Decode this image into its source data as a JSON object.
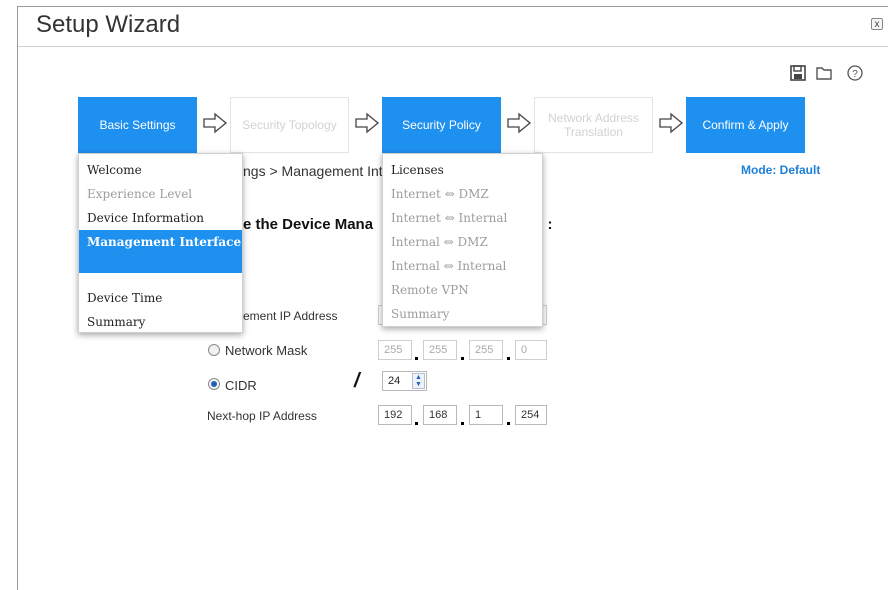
{
  "window": {
    "title": "Setup Wizard",
    "close_label": "x"
  },
  "toolbar": {
    "icons": [
      "save-icon",
      "folder-icon",
      "help-icon"
    ]
  },
  "steps": [
    {
      "label": "Basic Settings",
      "state": "active"
    },
    {
      "label": "Security Topology",
      "state": "inactive"
    },
    {
      "label": "Security Policy",
      "state": "active"
    },
    {
      "label": "Network Address Translation",
      "state": "inactive"
    },
    {
      "label": "Confirm & Apply",
      "state": "active"
    }
  ],
  "mode": "Mode: Default",
  "breadcrumb": "ngs > Management Int",
  "heading_left": "e the Device Mana",
  "heading_right": ")0) :",
  "basic_menu": [
    {
      "label": "Welcome",
      "state": "enabled"
    },
    {
      "label": "Experience Level",
      "state": "disabled"
    },
    {
      "label": "Device Information",
      "state": "enabled"
    },
    {
      "label": "Management Interface",
      "state": "selected"
    },
    {
      "label": "Device Time",
      "state": "enabled"
    },
    {
      "label": "Summary",
      "state": "enabled"
    }
  ],
  "policy_menu": [
    {
      "label": "Licenses",
      "state": "enabled"
    },
    {
      "label": "Internet ⇔ DMZ",
      "state": "disabled"
    },
    {
      "label": "Internet ⇔ Internal",
      "state": "disabled"
    },
    {
      "label": "Internal ⇔ DMZ",
      "state": "disabled"
    },
    {
      "label": "Internal ⇔ Internal",
      "state": "disabled"
    },
    {
      "label": "Remote VPN",
      "state": "disabled"
    },
    {
      "label": "Summary",
      "state": "disabled"
    }
  ],
  "form": {
    "mgmt_ip_label": "ement IP Address",
    "network_mask_label": "Network Mask",
    "network_mask": [
      "255",
      "255",
      "255",
      "0"
    ],
    "cidr_label": "CIDR",
    "cidr_slash": "/",
    "cidr_value": "24",
    "nexthop_label": "Next-hop IP Address",
    "nexthop": [
      "192",
      "168",
      "1",
      "254"
    ],
    "selected_mode": "CIDR"
  },
  "colors": {
    "accent": "#1e90f0",
    "mode_text": "#1e7fd8"
  }
}
